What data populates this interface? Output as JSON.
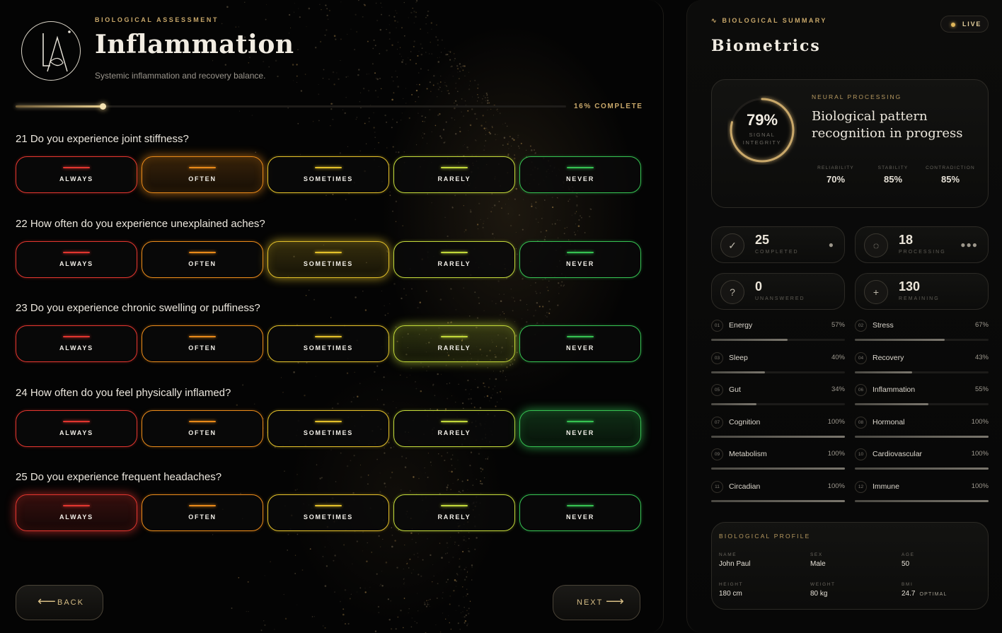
{
  "header": {
    "kicker": "BIOLOGICAL ASSESSMENT",
    "title": "Inflammation",
    "subtitle": "Systemic inflammation and recovery balance."
  },
  "progress": {
    "percent": 16,
    "label": "16% COMPLETE"
  },
  "options": [
    {
      "label": "ALWAYS",
      "color": "#e2362f"
    },
    {
      "label": "OFTEN",
      "color": "#e98a1a"
    },
    {
      "label": "SOMETIMES",
      "color": "#e3c02a"
    },
    {
      "label": "RARELY",
      "color": "#c2d83a"
    },
    {
      "label": "NEVER",
      "color": "#36c252"
    }
  ],
  "questions": [
    {
      "text": "21 Do you experience joint stiffness?",
      "selected": 1
    },
    {
      "text": "22 How often do you experience unexplained aches?",
      "selected": 2
    },
    {
      "text": "23 Do you experience chronic swelling or puffiness?",
      "selected": 3
    },
    {
      "text": "24 How often do you feel physically inflamed?",
      "selected": 4
    },
    {
      "text": "25 Do you experience frequent headaches?",
      "selected": 0
    }
  ],
  "nav": {
    "back": "BACK",
    "next": "NEXT"
  },
  "summary": {
    "kicker": "BIOLOGICAL SUMMARY",
    "title": "Biometrics",
    "live": "LIVE",
    "neural": {
      "percent_value": 79,
      "percent": "79%",
      "ring_label": "SIGNAL INTEGRITY",
      "kicker": "NEURAL PROCESSING",
      "headline": "Biological pattern recognition in progress",
      "stats": [
        {
          "label": "RELIABILITY",
          "value": "70%"
        },
        {
          "label": "STABILITY",
          "value": "85%"
        },
        {
          "label": "CONTRADICTION",
          "value": "85%"
        }
      ]
    },
    "tiles": [
      {
        "number": "25",
        "caption": "COMPLETED",
        "icon": "check-icon",
        "glyph": "✓",
        "tail": "●"
      },
      {
        "number": "18",
        "caption": "PROCESSING",
        "icon": "spinner-icon",
        "glyph": "◌",
        "tail": "●●●"
      },
      {
        "number": "0",
        "caption": "UNANSWERED",
        "icon": "question-icon",
        "glyph": "?",
        "tail": ""
      },
      {
        "number": "130",
        "caption": "REMAINING",
        "icon": "plus-icon",
        "glyph": "+",
        "tail": ""
      }
    ],
    "metrics": [
      {
        "index": "01",
        "name": "Energy",
        "value": 57,
        "label": "57%"
      },
      {
        "index": "02",
        "name": "Stress",
        "value": 67,
        "label": "67%"
      },
      {
        "index": "03",
        "name": "Sleep",
        "value": 40,
        "label": "40%"
      },
      {
        "index": "04",
        "name": "Recovery",
        "value": 43,
        "label": "43%"
      },
      {
        "index": "05",
        "name": "Gut",
        "value": 34,
        "label": "34%"
      },
      {
        "index": "06",
        "name": "Inflammation",
        "value": 55,
        "label": "55%"
      },
      {
        "index": "07",
        "name": "Cognition",
        "value": 100,
        "label": "100%"
      },
      {
        "index": "08",
        "name": "Hormonal",
        "value": 100,
        "label": "100%"
      },
      {
        "index": "09",
        "name": "Metabolism",
        "value": 100,
        "label": "100%"
      },
      {
        "index": "10",
        "name": "Cardiovascular",
        "value": 100,
        "label": "100%"
      },
      {
        "index": "11",
        "name": "Circadian",
        "value": 100,
        "label": "100%"
      },
      {
        "index": "12",
        "name": "Immune",
        "value": 100,
        "label": "100%"
      }
    ],
    "profile": {
      "kicker": "BIOLOGICAL PROFILE",
      "name_label": "NAME",
      "name": "John Paul",
      "sex_label": "SEX",
      "sex": "Male",
      "age_label": "AGE",
      "age": "50",
      "height_label": "HEIGHT",
      "height": "180 cm",
      "weight_label": "WEIGHT",
      "weight": "80 kg",
      "bmi_label": "BMI",
      "bmi": "24.7",
      "bmi_status": "OPTIMAL"
    }
  },
  "colors": {
    "accent": "#c9a86a",
    "background": "#050505"
  }
}
